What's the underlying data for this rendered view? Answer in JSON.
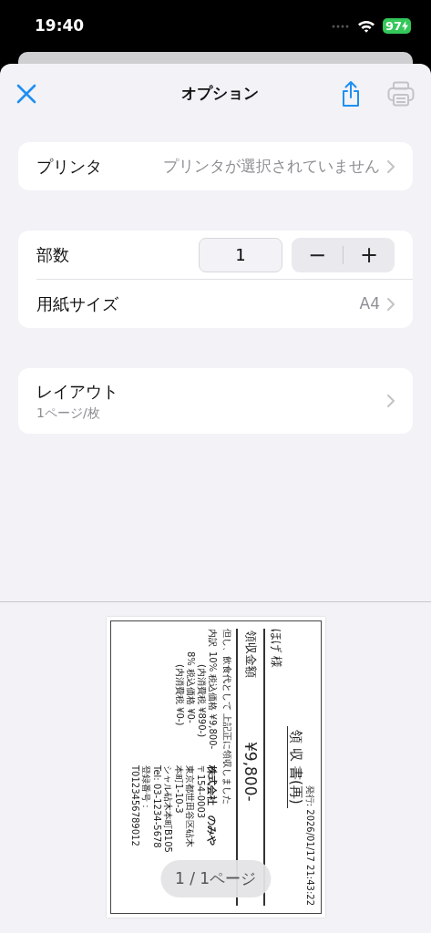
{
  "status_bar": {
    "time": "19:40",
    "battery": "97"
  },
  "nav": {
    "title": "オプション",
    "print_disabled": true
  },
  "printer": {
    "label": "プリンタ",
    "value": "プリンタが選択されていません"
  },
  "copies": {
    "label": "部数",
    "value": "1",
    "minus": "−",
    "plus": "+"
  },
  "paper": {
    "label": "用紙サイズ",
    "value": "A4"
  },
  "layout": {
    "label": "レイアウト",
    "detail": "1ページ/枚"
  },
  "preview": {
    "page_indicator": "1 / 1ページ",
    "receipt": {
      "issued": "発行: 2026/01/17 21:43:22",
      "title": "領 収 書(再)",
      "addressee": "ほげ 様",
      "amount_label": "領収金額",
      "amount": "¥9,800-",
      "note": "但し、飲食代として 上記正に領収しました",
      "breakdown_label": "内訳",
      "breakdown": [
        {
          "kind": "rate",
          "text": "10% 税込価格 ¥9,800-"
        },
        {
          "kind": "tax",
          "text": "(内消費税 ¥890-)"
        },
        {
          "kind": "rate",
          "text": "8% 税込価格 ¥0-"
        },
        {
          "kind": "tax",
          "text": "(内消費税 ¥0-)"
        }
      ],
      "company": "株式会社　のみや",
      "postal": "〒154-0003",
      "address": [
        "東京都世田谷区砧木本町1-10-3",
        "シャル砧木本町B105"
      ],
      "tel": "Tel: 03-1234-5678",
      "registration": "登録番号：T0123456789012"
    }
  }
}
